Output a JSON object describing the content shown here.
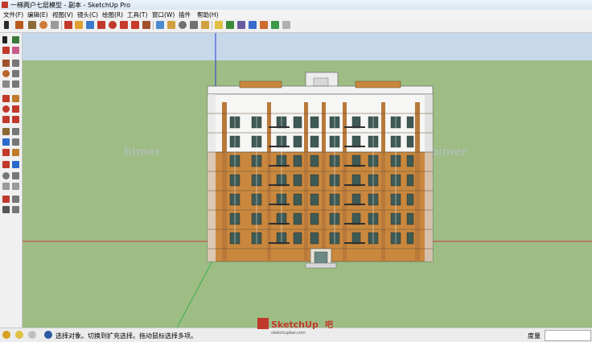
{
  "window": {
    "title": "一梯两户七层模型 - 副本 - SketchUp Pro"
  },
  "menu": [
    {
      "label": "文件(F)"
    },
    {
      "label": "编辑(E)"
    },
    {
      "label": "视图(V)"
    },
    {
      "label": "镜头(C)"
    },
    {
      "label": "绘图(R)"
    },
    {
      "label": "工具(T)"
    },
    {
      "label": "窗口(W)"
    },
    {
      "label": "插件"
    },
    {
      "label": "帮助(H)"
    }
  ],
  "viewport": {
    "watermark_left": "bimer",
    "watermark_right": "bimer"
  },
  "statusbar": {
    "hint": "选择对象。切换到扩充选择。拖动鼠标选择多项。",
    "measure_label": "度量"
  },
  "branding": {
    "logo_text": "SketchUp",
    "logo_badge": "吧",
    "logo_url": "sketchupbar.com"
  },
  "colors": {
    "sky": "#c7d8ea",
    "ground": "#9dbd84",
    "accent_brown": "#c9883e",
    "wall_white": "#f6f6f4"
  },
  "icons": {
    "toolbar": [
      "select-icon",
      "pencil-icon",
      "rectangle-icon",
      "circle-icon",
      "eraser-icon",
      "paint-bucket-icon",
      "pushpull-icon",
      "move-icon",
      "rotate-icon",
      "scale-icon",
      "offset-icon",
      "followme-icon",
      "tape-icon",
      "protractor-icon",
      "axes-icon",
      "text-icon",
      "section-icon",
      "orbit-icon",
      "pan-icon",
      "zoom-icon",
      "zoom-window-icon",
      "zoom-extents-icon",
      "previous-icon",
      "model-info-icon",
      "components-icon",
      "materials-icon",
      "shadows-icon",
      "fog-icon",
      "geo-icon",
      "warehouse-icon",
      "upload-icon",
      "extension-icon",
      "help-icon"
    ],
    "left": [
      "select-icon",
      "component-icon",
      "paint-icon",
      "eraser-icon",
      "rectangle-icon",
      "line-icon",
      "circle-icon",
      "arc-icon",
      "polygon-icon",
      "freehand-icon",
      "move-icon",
      "pushpull-icon",
      "rotate-icon",
      "followme-icon",
      "scale-icon",
      "offset-icon",
      "tape-icon",
      "dimension-icon",
      "protractor-icon",
      "text-icon",
      "axes-icon",
      "3dtext-icon",
      "orbit-icon",
      "pan-icon",
      "zoom-icon",
      "zoom-window-icon",
      "zoom-extents-icon",
      "previous-icon",
      "position-camera-icon",
      "lookaround-icon",
      "walk-icon",
      "section-icon"
    ]
  }
}
